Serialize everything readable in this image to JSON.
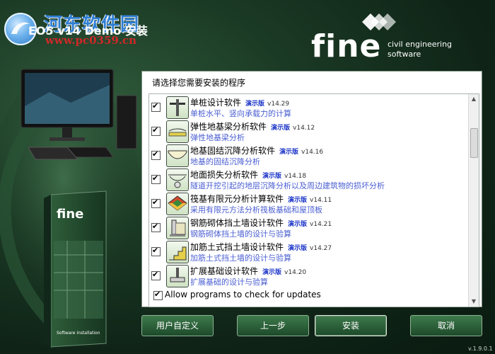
{
  "watermark": {
    "site": "河东软件园",
    "url": "www.pc0359.cn"
  },
  "window": {
    "title": "EO5 v14 Demo 安装"
  },
  "brand": {
    "word": "fine",
    "tagline1": "civil engineering",
    "tagline2": "software"
  },
  "panel": {
    "header": "请选择您需要安装的程序",
    "items": [
      {
        "title": "单桩设计软件",
        "badge": "演示版",
        "version": "v14.29",
        "desc": "单桩水平、竖向承载力的计算",
        "icon": "pile-icon"
      },
      {
        "title": "弹性地基梁分析软件",
        "badge": "演示版",
        "version": "v14.12",
        "desc": "弹性地基梁分析",
        "icon": "beam-icon"
      },
      {
        "title": "地基固结沉降分析软件",
        "badge": "演示版",
        "version": "v14.16",
        "desc": "地基的固结沉降分析",
        "icon": "settlement-icon"
      },
      {
        "title": "地面损失分析软件",
        "badge": "演示版",
        "version": "v14.18",
        "desc": "隧道开挖引起的地层沉降分析以及周边建筑物的损坏分析",
        "icon": "tunnel-icon"
      },
      {
        "title": "筏基有限元分析计算软件",
        "badge": "演示版",
        "version": "v14.11",
        "desc": "采用有限元方法分析筏板基础和屋顶板",
        "icon": "raft-icon"
      },
      {
        "title": "钢筋砌体挡土墙设计软件",
        "badge": "演示版",
        "version": "v14.21",
        "desc": "钢筋砌体挡土墙的设计与验算",
        "icon": "masonry-wall-icon"
      },
      {
        "title": "加筋土式挡土墙设计软件",
        "badge": "演示版",
        "version": "v14.27",
        "desc": "加筋土式挡土墙的设计与验算",
        "icon": "reinforced-wall-icon"
      },
      {
        "title": "扩展基础设计软件",
        "badge": "演示版",
        "version": "v14.20",
        "desc": "扩展基础的设计与验算",
        "icon": "spread-footing-icon"
      }
    ],
    "update_label": "Allow programs to check for updates"
  },
  "buttons": {
    "custom": "用户自定义",
    "back": "上一步",
    "install": "安装",
    "cancel": "取消"
  },
  "footer_version": "v.1.9.0.1",
  "box_art": {
    "word": "fine",
    "caption": "Software installation"
  },
  "colors": {
    "accent_green": "#1d4a2a",
    "demo_blue": "#1a33c8",
    "desc_blue": "#4b5fd2"
  }
}
